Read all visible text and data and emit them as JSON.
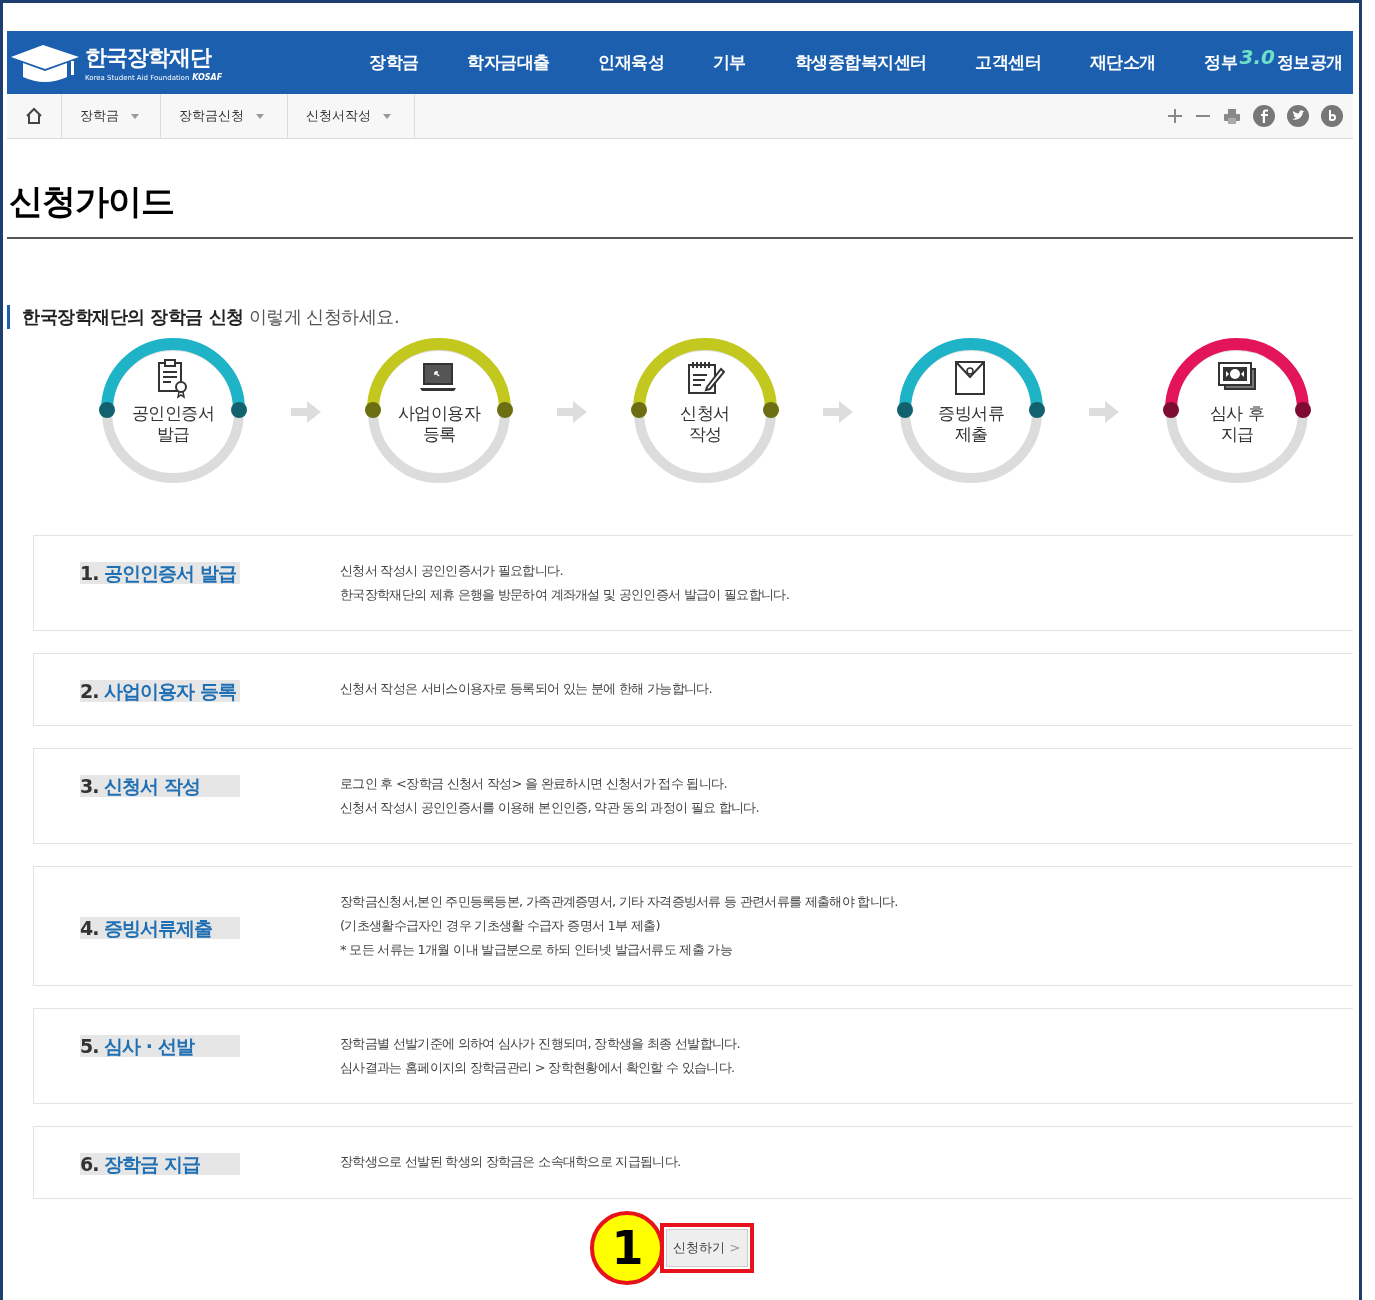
{
  "header": {
    "logo": {
      "name": "한국장학재단",
      "subtitle": "Korea Student Aid Foundation",
      "brand": "KOSAF"
    },
    "nav": [
      {
        "label": "장학금"
      },
      {
        "label": "학자금대출"
      },
      {
        "label": "인재육성"
      },
      {
        "label": "기부"
      },
      {
        "label": "학생종합복지센터"
      },
      {
        "label": "고객센터"
      },
      {
        "label": "재단소개"
      },
      {
        "label": "정부",
        "badge": "3.0",
        "suffix": "정보공개"
      }
    ]
  },
  "breadcrumb": {
    "items": [
      {
        "label": "장학금"
      },
      {
        "label": "장학금신청"
      },
      {
        "label": "신청서작성"
      }
    ]
  },
  "page_title": "신청가이드",
  "intro": {
    "bold": "한국장학재단의 장학금 신청",
    "rest": "이렇게 신청하세요."
  },
  "steps": [
    {
      "kind": "certificate",
      "lines": [
        "공인인증서",
        "발급"
      ],
      "color": "#1fb3c8"
    },
    {
      "kind": "laptop",
      "lines": [
        "사업이용자",
        "등록"
      ],
      "color": "#c3c81f"
    },
    {
      "kind": "notepad",
      "lines": [
        "신청서",
        "작성"
      ],
      "color": "#c3c81f"
    },
    {
      "kind": "envelope",
      "lines": [
        "증빙서류",
        "제출"
      ],
      "color": "#1fb3c8"
    },
    {
      "kind": "cash",
      "lines": [
        "심사 후",
        "지급"
      ],
      "color": "#e3145a"
    }
  ],
  "sections": [
    {
      "number": "1.",
      "title": "공인인증서 발급",
      "lines": [
        "신청서 작성시 공인인증서가 필요합니다.",
        "한국장학재단의 제휴 은행을 방문하여 계좌개설 및 공인인증서 발급이 필요합니다."
      ]
    },
    {
      "number": "2.",
      "title": "사업이용자 등록",
      "lines": [
        "신청서 작성은 서비스이용자로 등록되어 있는 분에 한해 가능합니다."
      ]
    },
    {
      "number": "3.",
      "title": "신청서 작성",
      "lines": [
        "로그인 후 <장학금 신청서 작성> 을 완료하시면 신청서가 접수 됩니다.",
        "신청서 작성시 공인인증서를 이용해 본인인증, 약관 동의 과정이 필요 합니다."
      ]
    },
    {
      "number": "4.",
      "title": "증빙서류제출",
      "lines": [
        "장학금신청서,본인 주민등록등본, 가족관계증명서, 기타 자격증빙서류 등 관련서류를 제출해야 합니다.",
        "(기초생활수급자인 경우 기초생활 수급자 증명서 1부 제출)",
        "* 모든 서류는 1개월 이내 발급분으로 하되 인터넷 발급서류도 제출 가능"
      ]
    },
    {
      "number": "5.",
      "title": "심사 · 선발",
      "lines": [
        "장학금별 선발기준에 의하여 심사가 진행되며, 장학생을 최종 선발합니다.",
        "심사결과는 홈페이지의 장학금관리 > 장학현황에서 확인할 수 있습니다."
      ]
    },
    {
      "number": "6.",
      "title": "장학금 지급",
      "lines": [
        "장학생으로 선발된 학생의 장학금은 소속대학으로 지급됩니다."
      ]
    }
  ],
  "apply_button": {
    "label": "신청하기",
    "chevron": ">"
  },
  "callout": {
    "label": "1"
  }
}
